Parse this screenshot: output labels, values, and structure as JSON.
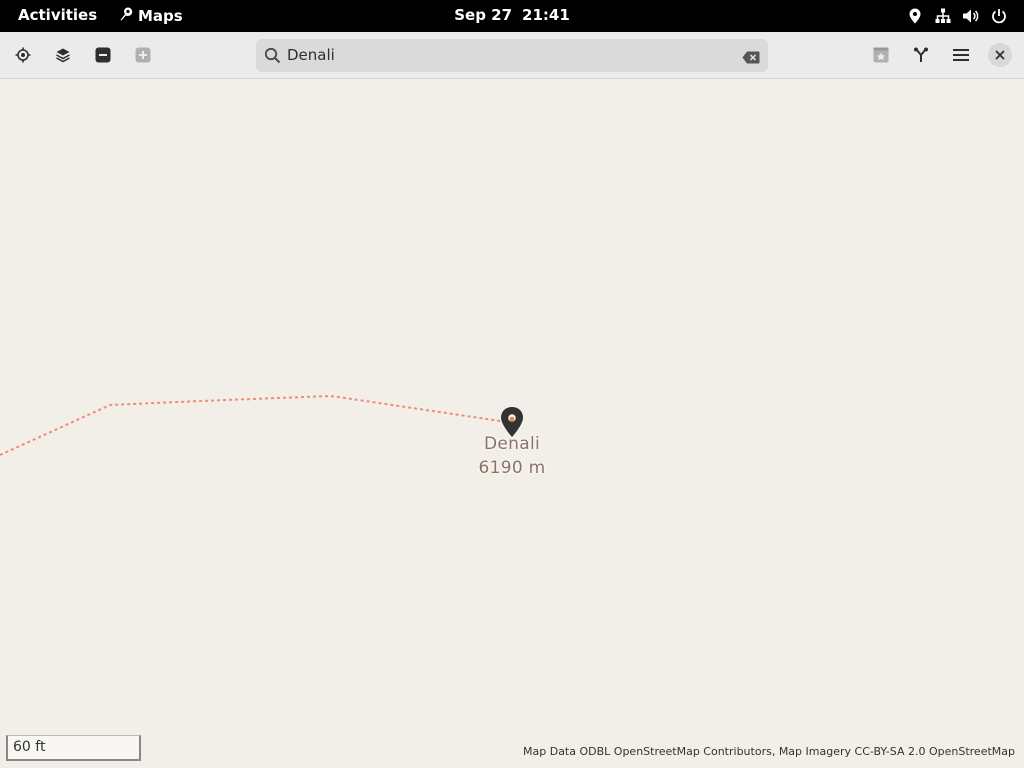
{
  "topbar": {
    "activities": "Activities",
    "app_name": "Maps",
    "date": "Sep 27",
    "time": "21:41",
    "icons": [
      "location-icon",
      "network-icon",
      "volume-icon",
      "power-icon"
    ]
  },
  "headerbar": {
    "search": {
      "value": "Denali"
    },
    "buttons": [
      "locate-me",
      "map-layers",
      "zoom-out",
      "zoom-in",
      "favorites",
      "route-planner",
      "main-menu",
      "close"
    ]
  },
  "map": {
    "place_name": "Denali",
    "place_elevation": "6190 m",
    "scale_label": "60 ft",
    "attribution": "Map Data ODBL OpenStreetMap Contributors, Map Imagery CC-BY-SA 2.0 OpenStreetMap",
    "route_color": "#f08a7a",
    "pin_color": "#333333"
  }
}
